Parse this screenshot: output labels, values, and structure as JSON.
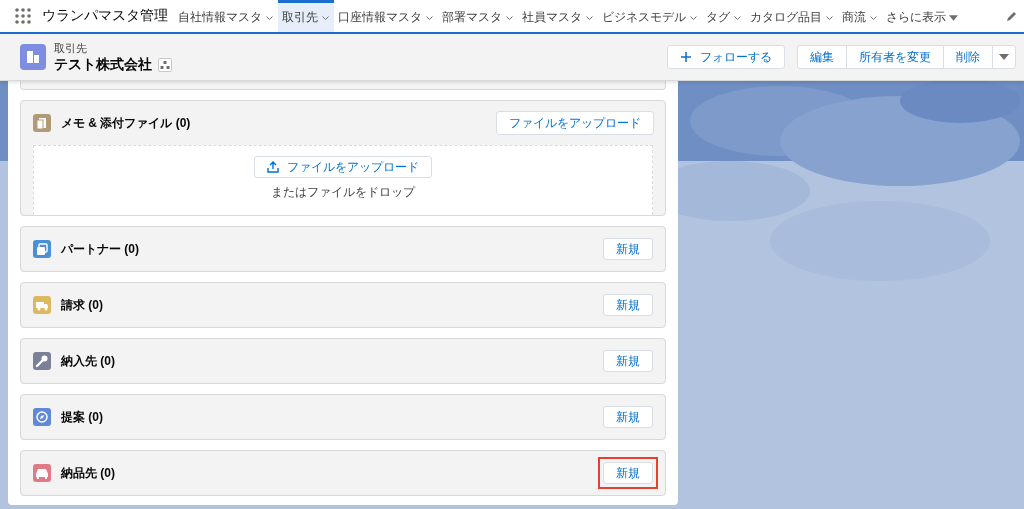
{
  "app_name": "ウランパマスタ管理",
  "nav_items": [
    {
      "label": "自社情報マスタ",
      "selected": false
    },
    {
      "label": "取引先",
      "selected": true
    },
    {
      "label": "口座情報マスタ",
      "selected": false
    },
    {
      "label": "部署マスタ",
      "selected": false
    },
    {
      "label": "社員マスタ",
      "selected": false
    },
    {
      "label": "ビジネスモデル",
      "selected": false
    },
    {
      "label": "タグ",
      "selected": false
    },
    {
      "label": "カタログ品目",
      "selected": false
    },
    {
      "label": "商流",
      "selected": false
    }
  ],
  "nav_more": "さらに表示",
  "record": {
    "object_label": "取引先",
    "name": "テスト株式会社"
  },
  "actions": {
    "follow": "フォローする",
    "buttons": [
      "編集",
      "所有者を変更",
      "削除"
    ]
  },
  "files_card": {
    "title": "メモ & 添付ファイル (0)",
    "header_button": "ファイルをアップロード",
    "upload_button": "ファイルをアップロード",
    "drop_text": "またはファイルをドロップ"
  },
  "related_lists": [
    {
      "kind": "partner",
      "color": "#4a90d9",
      "title": "パートナー (0)",
      "button": "新規",
      "highlighted": false
    },
    {
      "kind": "truck",
      "color": "#dcb860",
      "title": "請求 (0)",
      "button": "新規",
      "highlighted": false
    },
    {
      "kind": "wrench",
      "color": "#7b8096",
      "title": "納入先 (0)",
      "button": "新規",
      "highlighted": false
    },
    {
      "kind": "compass",
      "color": "#5f88d8",
      "title": "提案 (0)",
      "button": "新規",
      "highlighted": false
    },
    {
      "kind": "car",
      "color": "#e07a86",
      "title": "納品先 (0)",
      "button": "新規",
      "highlighted": true
    }
  ]
}
